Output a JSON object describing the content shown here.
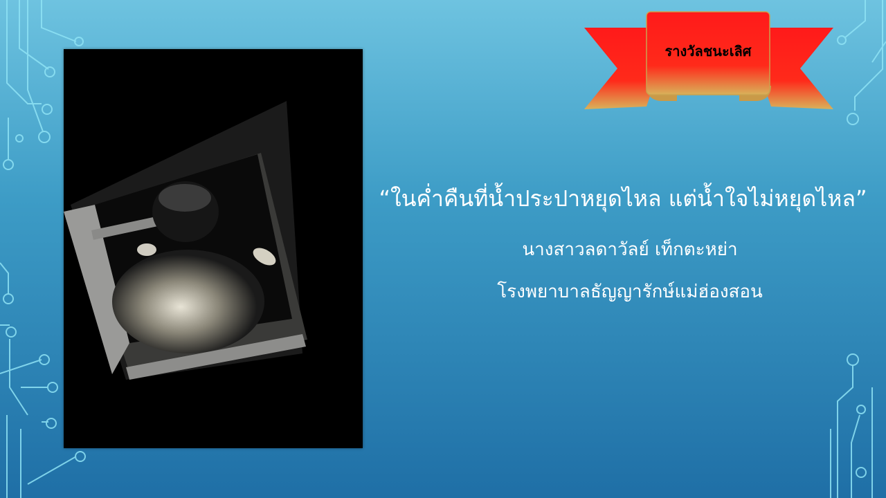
{
  "slide": {
    "award_label": "รางวัลชนะเลิศ",
    "quote": "“ในค่ำคืนที่น้ำประปาหยุดไหล แต่น้ำใจไม่หยุดไหล”",
    "author": "นางสาวลดาวัลย์ เท็กตะหย่า",
    "hospital": "โรงพยาบาลธัญญารักษ์แม่ฮ่องสอน"
  },
  "colors": {
    "background_top": "#6ec3e0",
    "background_bottom": "#1f6fa6",
    "ribbon_red": "#ff1a1a",
    "ribbon_gold": "#d9b25a",
    "circuit_line": "#8fe3f5"
  }
}
